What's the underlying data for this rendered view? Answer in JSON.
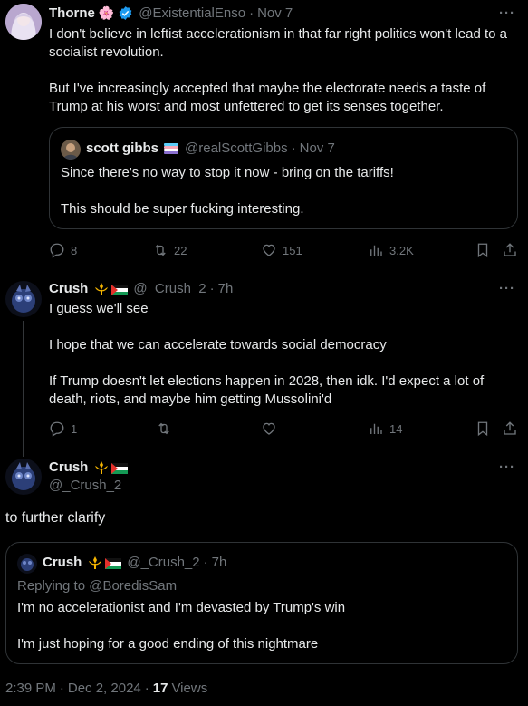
{
  "tweet1": {
    "name": "Thorne",
    "name_emoji": "🌸",
    "handle": "@ExistentialEnso",
    "date": "Nov 7",
    "more": "···",
    "para1": "I don't believe in leftist accelerationism in that far right politics won't lead to a socialist revolution.",
    "para2": "But I've increasingly accepted that maybe the electorate needs a taste of Trump at his worst and most unfettered to get its senses together.",
    "quote": {
      "name": "scott gibbs",
      "handle": "@realScottGibbs",
      "date": "Nov 7",
      "line1": "Since there's no way to stop it now - bring on the tariffs!",
      "line2": "This should be super fucking interesting."
    },
    "actions": {
      "replies": "8",
      "reposts": "22",
      "likes": "151",
      "views": "3.2K"
    }
  },
  "tweet2": {
    "name": "Crush",
    "handle": "@_Crush_2",
    "time": "7h",
    "more": "···",
    "para1": "I guess we'll see",
    "para2": "I hope that we can accelerate towards social democracy",
    "para3": "If Trump doesn't let elections happen in 2028, then idk. I'd expect a lot of death, riots, and maybe him getting Mussolini'd",
    "actions": {
      "replies": "1",
      "reposts": "",
      "likes": "",
      "views": "14"
    }
  },
  "tweet3": {
    "name": "Crush",
    "handle": "@_Crush_2",
    "more": "···",
    "text": "to further clarify",
    "quote": {
      "name": "Crush",
      "handle": "@_Crush_2",
      "time": "7h",
      "replying": "Replying to @BoredisSam",
      "line1": "I'm no accelerationist and I'm devasted by Trump's win",
      "line2": "I'm just hoping for a good ending of this nightmare"
    },
    "footer": {
      "time": "2:39 PM",
      "date": "Dec 2, 2024",
      "views_count": "17",
      "views_label": "Views"
    }
  },
  "colors": {
    "background": "#000000",
    "text": "#e7e9ea",
    "muted": "#71767b",
    "verified": "#1d9bf0",
    "border": "#2f3336"
  }
}
